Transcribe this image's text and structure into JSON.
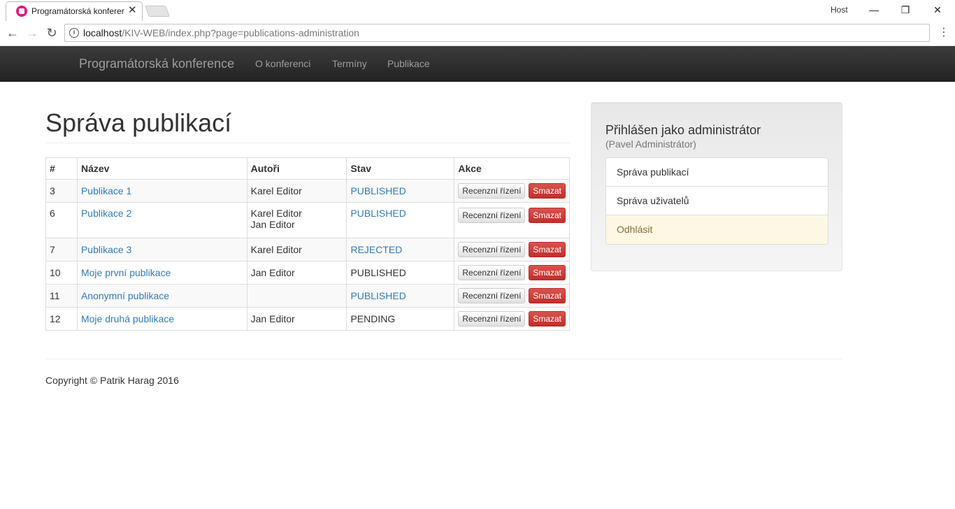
{
  "browser": {
    "tab_title": "Programátorská konferer",
    "profile": "Host",
    "url_host": "localhost",
    "url_path": "/KIV-WEB/index.php?page=publications-administration"
  },
  "navbar": {
    "brand": "Programátorská konference",
    "links": [
      "O konferenci",
      "Termíny",
      "Publikace"
    ]
  },
  "main": {
    "title": "Správa publikací",
    "table": {
      "headers": [
        "#",
        "Název",
        "Autoři",
        "Stav",
        "Akce"
      ],
      "review_label": "Recenzní řízení",
      "delete_label": "Smazat",
      "rows": [
        {
          "id": "3",
          "name": "Publikace 1",
          "authors": [
            "Karel Editor"
          ],
          "state": "PUBLISHED",
          "state_link": true
        },
        {
          "id": "6",
          "name": "Publikace 2",
          "authors": [
            "Karel Editor",
            "Jan Editor"
          ],
          "state": "PUBLISHED",
          "state_link": true
        },
        {
          "id": "7",
          "name": "Publikace 3",
          "authors": [
            "Karel Editor"
          ],
          "state": "REJECTED",
          "state_link": true
        },
        {
          "id": "10",
          "name": "Moje první publikace",
          "authors": [
            "Jan Editor"
          ],
          "state": "PUBLISHED",
          "state_link": false
        },
        {
          "id": "11",
          "name": "Anonymní publikace",
          "authors": [],
          "state": "PUBLISHED",
          "state_link": true
        },
        {
          "id": "12",
          "name": "Moje druhá publikace",
          "authors": [
            "Jan Editor"
          ],
          "state": "PENDING",
          "state_link": false
        }
      ]
    }
  },
  "sidebar": {
    "title": "Přihlášen jako administrátor",
    "subtitle": "(Pavel Administrátor)",
    "items": [
      "Správa publikací",
      "Správa uživatelů",
      "Odhlásit"
    ]
  },
  "footer": {
    "copyright": "Copyright © Patrik Harag 2016"
  },
  "colors": {
    "link": "#337ab7",
    "danger": "#d9534f",
    "warning_bg": "#fcf8e3"
  }
}
